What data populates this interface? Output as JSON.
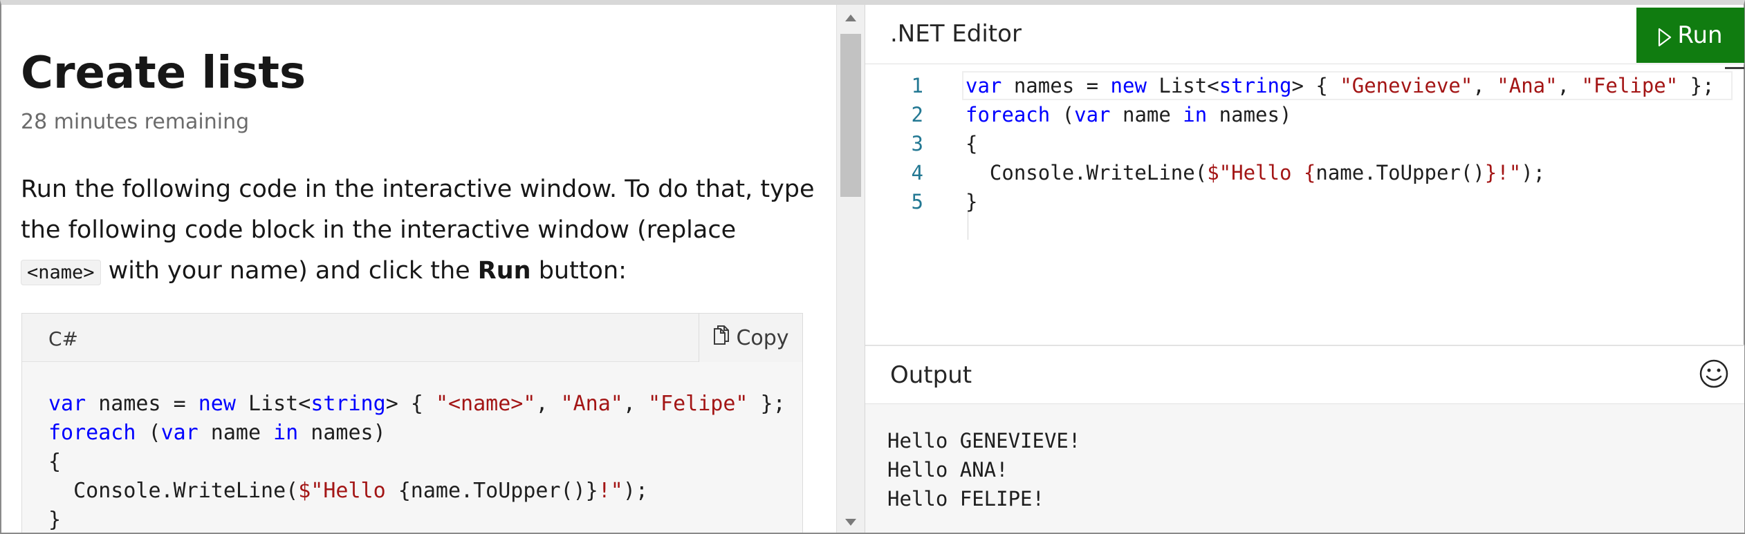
{
  "lesson": {
    "title": "Create lists",
    "time_remaining": "28 minutes remaining",
    "instructions": {
      "part1": "Run the following code in the interactive window. To do that, type the following code block in the interactive window (replace ",
      "inline_code": "<name>",
      "part2": " with your name) and click the ",
      "bold_word": "Run",
      "part3": " button:"
    },
    "code_card": {
      "language": "C#",
      "copy_label": "Copy",
      "lines": [
        [
          {
            "t": "var",
            "c": "kw"
          },
          {
            "t": " names = ",
            "c": ""
          },
          {
            "t": "new",
            "c": "kw"
          },
          {
            "t": " List<",
            "c": ""
          },
          {
            "t": "string",
            "c": "kw"
          },
          {
            "t": "> { ",
            "c": ""
          },
          {
            "t": "\"<name>\"",
            "c": "str"
          },
          {
            "t": ", ",
            "c": ""
          },
          {
            "t": "\"Ana\"",
            "c": "str"
          },
          {
            "t": ", ",
            "c": ""
          },
          {
            "t": "\"Felipe\"",
            "c": "str"
          },
          {
            "t": " };",
            "c": ""
          }
        ],
        [
          {
            "t": "foreach",
            "c": "kw"
          },
          {
            "t": " (",
            "c": ""
          },
          {
            "t": "var",
            "c": "kw"
          },
          {
            "t": " name ",
            "c": ""
          },
          {
            "t": "in",
            "c": "kw"
          },
          {
            "t": " names)",
            "c": ""
          }
        ],
        [
          {
            "t": "{",
            "c": ""
          }
        ],
        [
          {
            "t": "  Console.WriteLine(",
            "c": ""
          },
          {
            "t": "$\"Hello ",
            "c": "str"
          },
          {
            "t": "{name.ToUpper()}",
            "c": ""
          },
          {
            "t": "!\"",
            "c": "str"
          },
          {
            "t": ");",
            "c": ""
          }
        ],
        [
          {
            "t": "}",
            "c": ""
          }
        ]
      ]
    }
  },
  "editor": {
    "title": ".NET Editor",
    "run_label": "Run",
    "line_numbers": [
      "1",
      "2",
      "3",
      "4",
      "5"
    ],
    "lines": [
      [
        {
          "t": "var",
          "c": "kw"
        },
        {
          "t": " names = ",
          "c": ""
        },
        {
          "t": "new",
          "c": "kw"
        },
        {
          "t": " List<",
          "c": ""
        },
        {
          "t": "string",
          "c": "kw"
        },
        {
          "t": "> { ",
          "c": ""
        },
        {
          "t": "\"Genevieve\"",
          "c": "str"
        },
        {
          "t": ", ",
          "c": ""
        },
        {
          "t": "\"Ana\"",
          "c": "str"
        },
        {
          "t": ", ",
          "c": ""
        },
        {
          "t": "\"Felipe\"",
          "c": "str"
        },
        {
          "t": " };",
          "c": ""
        }
      ],
      [
        {
          "t": "foreach",
          "c": "kw"
        },
        {
          "t": " (",
          "c": ""
        },
        {
          "t": "var",
          "c": "kw"
        },
        {
          "t": " name ",
          "c": ""
        },
        {
          "t": "in",
          "c": "kw"
        },
        {
          "t": " names)",
          "c": ""
        }
      ],
      [
        {
          "t": "{",
          "c": ""
        }
      ],
      [
        {
          "t": "  Console.WriteLine(",
          "c": ""
        },
        {
          "t": "$\"Hello ",
          "c": "str"
        },
        {
          "t": "{",
          "c": "str"
        },
        {
          "t": "name.ToUpper()",
          "c": ""
        },
        {
          "t": "}",
          "c": "str"
        },
        {
          "t": "!\"",
          "c": "str"
        },
        {
          "t": ");",
          "c": ""
        }
      ],
      [
        {
          "t": "}",
          "c": ""
        }
      ]
    ]
  },
  "output": {
    "title": "Output",
    "lines": [
      "Hello GENEVIEVE!",
      "Hello ANA!",
      "Hello FELIPE!"
    ]
  },
  "colors": {
    "run_button": "#107c10",
    "keyword": "#0000ff",
    "string": "#a31515",
    "line_number": "#237893"
  },
  "icons": {
    "copy": "copy-icon",
    "run": "play-icon",
    "feedback": "smiley-icon"
  }
}
